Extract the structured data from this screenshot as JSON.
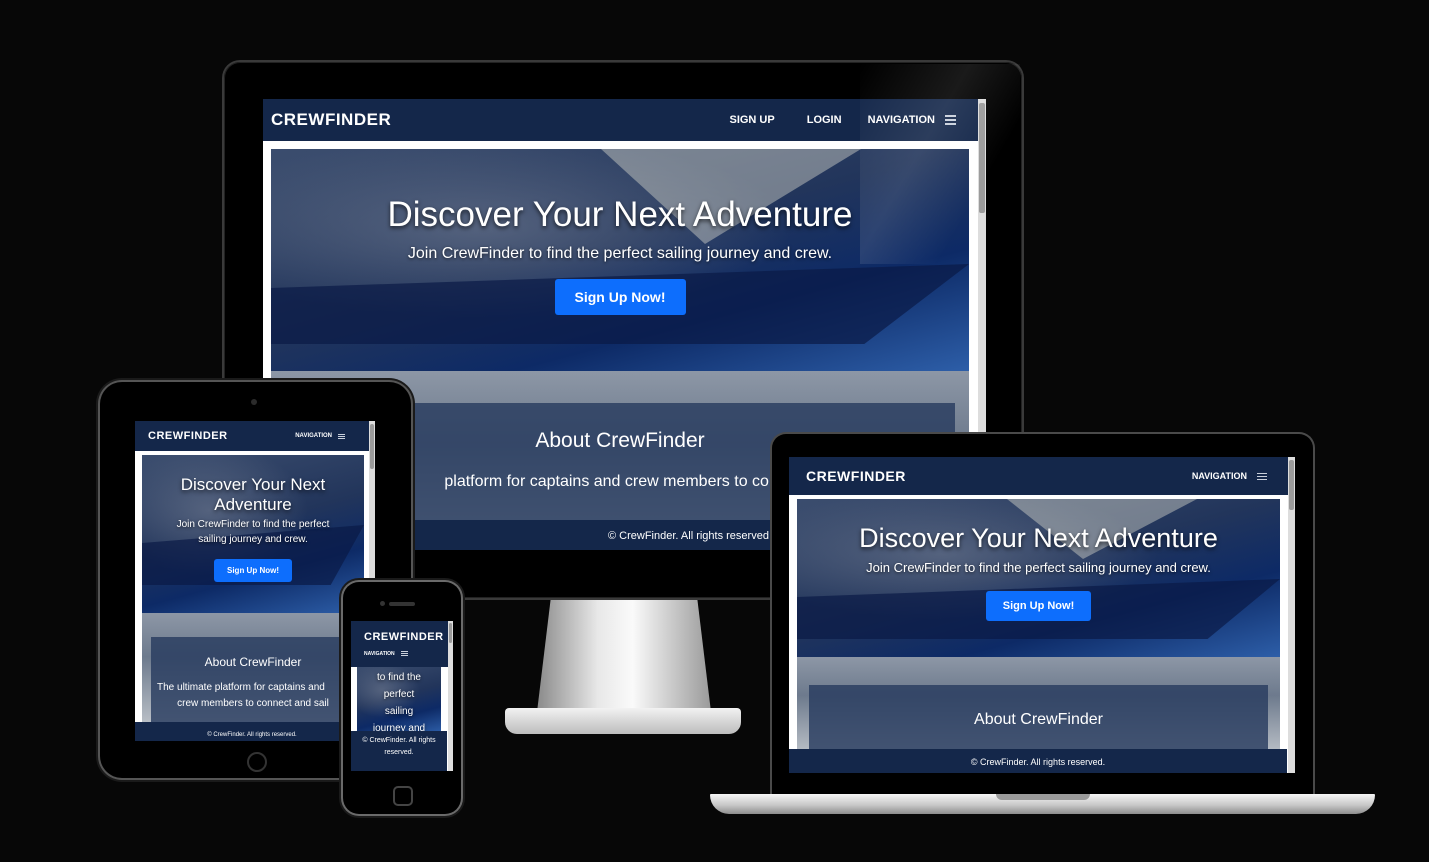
{
  "site": {
    "brand": "CREWFINDER",
    "nav": {
      "signup": "SIGN UP",
      "login": "LOGIN",
      "navigation": "NAVIGATION"
    },
    "hero": {
      "title": "Discover Your Next Adventure",
      "subtitle": "Join CrewFinder to find the perfect sailing journey and crew.",
      "cta": "Sign Up Now!"
    },
    "about": {
      "title": "About CrewFinder",
      "text": "The ultimate platform for captains and crew members to connect and sail together."
    },
    "footer": "© CrewFinder. All rights reserved."
  },
  "desktop": {
    "about_fragment": "platform for captains and crew members to conne"
  },
  "tablet": {
    "hero_title_line1": "Discover Your Next",
    "hero_title_line2": "Adventure",
    "hero_sub_line1": "Join CrewFinder to find the perfect",
    "hero_sub_line2": "sailing journey and crew.",
    "about_line1": "The ultimate platform for captains and",
    "about_line2": "crew members to connect and sail"
  },
  "phone": {
    "hero_fragment_1": "to find the",
    "hero_fragment_2": "perfect",
    "hero_fragment_3": "sailing",
    "hero_fragment_4": "journey and",
    "footer_line1": "© CrewFinder. All rights",
    "footer_line2": "reserved."
  },
  "colors": {
    "navbar": "#14274a",
    "cta": "#0d6efd",
    "background": "#070707"
  }
}
